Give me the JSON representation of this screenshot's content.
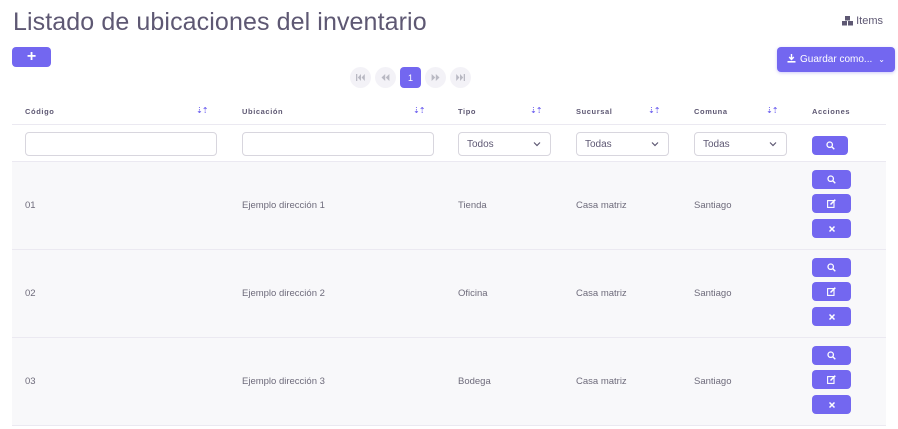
{
  "page": {
    "title": "Listado de ubicaciones del inventario",
    "items_link": "Items"
  },
  "toolbar": {
    "add_label": "+",
    "save_label": "Guardar como..."
  },
  "pagination": {
    "first": "⏮",
    "prev": "⏪",
    "current": "1",
    "next": "⏩",
    "last": "⏭"
  },
  "table": {
    "columns": [
      {
        "label": "Código"
      },
      {
        "label": "Ubicación"
      },
      {
        "label": "Tipo"
      },
      {
        "label": "Sucursal"
      },
      {
        "label": "Comuna"
      },
      {
        "label": "Acciones"
      }
    ],
    "sort_label": "⇣⇡",
    "filters": {
      "tipo": "Todos",
      "sucursal": "Todas",
      "comuna": "Todas"
    },
    "rows": [
      {
        "codigo": "01",
        "ubicacion": "Ejemplo dirección 1",
        "tipo": "Tienda",
        "sucursal": "Casa matriz",
        "comuna": "Santiago"
      },
      {
        "codigo": "02",
        "ubicacion": "Ejemplo dirección 2",
        "tipo": "Oficina",
        "sucursal": "Casa matriz",
        "comuna": "Santiago"
      },
      {
        "codigo": "03",
        "ubicacion": "Ejemplo dirección 3",
        "tipo": "Bodega",
        "sucursal": "Casa matriz",
        "comuna": "Santiago"
      }
    ]
  },
  "colors": {
    "primary": "#7367f0",
    "title": "#5e5873",
    "row_bg": "#f8f8fa",
    "border": "#ebe9f1"
  }
}
